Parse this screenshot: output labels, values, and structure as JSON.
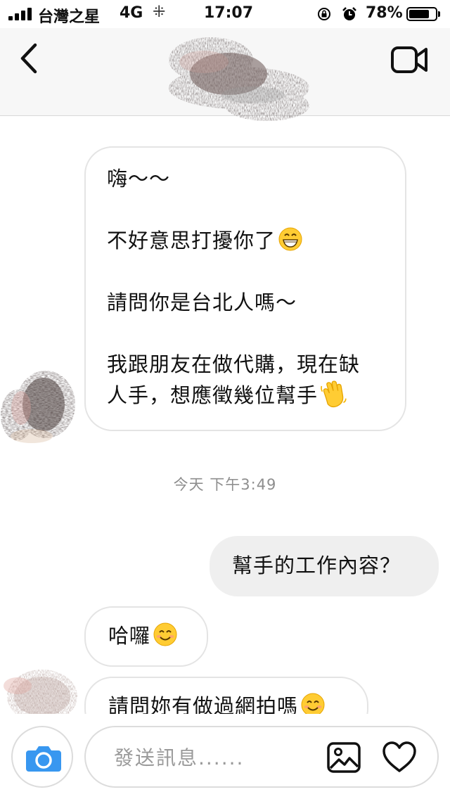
{
  "status_bar": {
    "carrier": "台灣之星",
    "network": "4G",
    "loading_glyph": "⁜",
    "time": "17:07",
    "battery_percent": "78%",
    "battery_level": 0.78,
    "icons": [
      "signal-bars-icon",
      "loading-spinner-icon",
      "orientation-lock-icon",
      "alarm-icon",
      "battery-icon"
    ]
  },
  "header": {
    "back_icon": "chevron-left-icon",
    "video_icon": "video-camera-icon",
    "contact_name_visible": false
  },
  "messages": [
    {
      "direction": "received",
      "lines": [
        "嗨～～",
        "",
        "不好意思打擾你了",
        "",
        "請問你是台北人嗎～",
        "",
        "我跟朋友在做代購，現在缺",
        "人手，想應徵幾位幫手"
      ],
      "emojis": [
        "grinning-face-emoji",
        "waving-hand-emoji"
      ]
    },
    {
      "direction": "sent",
      "text": "幫手的工作內容？"
    },
    {
      "direction": "received",
      "text": "哈囉",
      "emojis": [
        "smiling-face-emoji"
      ]
    },
    {
      "direction": "received",
      "text": "請問妳有做過網拍嗎",
      "emojis": [
        "smiling-face-emoji"
      ]
    }
  ],
  "timestamp": "今天 下午3:49",
  "composer": {
    "placeholder": "發送訊息......",
    "camera_icon": "camera-icon",
    "gallery_icon": "image-gallery-icon",
    "like_icon": "heart-icon"
  },
  "colors": {
    "header_bg": "#f7f7f7",
    "sent_bubble": "#efefef",
    "received_border": "#e4e4e4",
    "timestamp": "#8e8e8e",
    "camera_button": "#3897f0",
    "placeholder": "#9a9a9a"
  }
}
